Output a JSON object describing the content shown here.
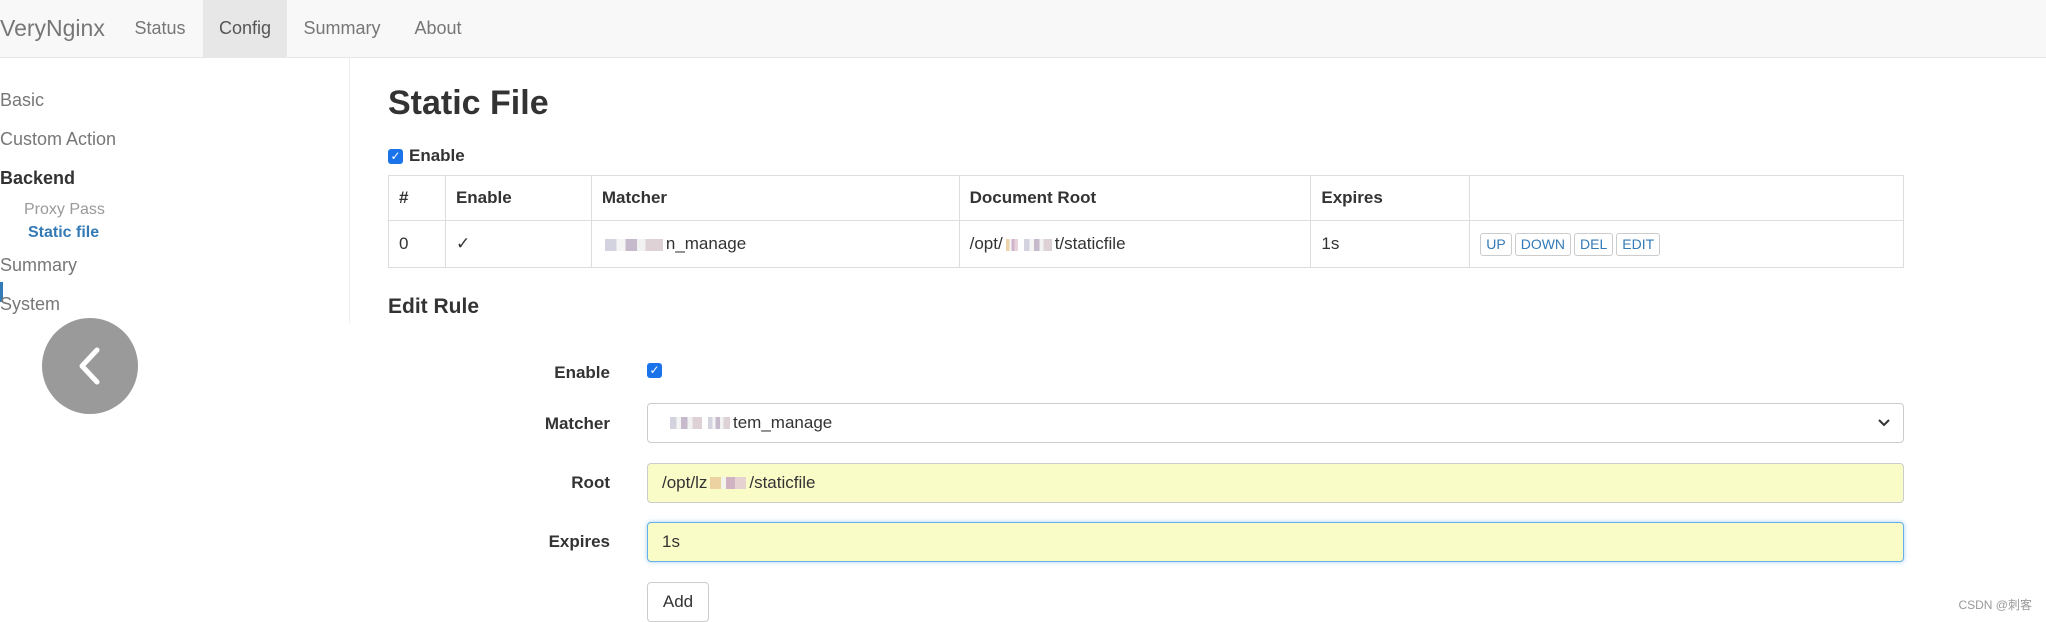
{
  "navbar": {
    "brand": "VeryNginx",
    "items": [
      "Status",
      "Config",
      "Summary",
      "About"
    ],
    "active": "Config"
  },
  "sidebar": {
    "basic": "Basic",
    "custom_action": "Custom Action",
    "backend": "Backend",
    "proxy_pass": "Proxy Pass",
    "static_file": "Static file",
    "summary": "Summary",
    "system": "System",
    "back_icon": "chevron-left-icon"
  },
  "main": {
    "title": "Static File",
    "enable_label": "Enable",
    "table": {
      "headers": [
        "#",
        "Enable",
        "Matcher",
        "Document Root",
        "Expires",
        ""
      ],
      "rows": [
        {
          "index": "0",
          "enable": "✓",
          "matcher_suffix": "n_manage",
          "root_prefix": "/opt/",
          "root_suffix": "t/staticfile",
          "expires": "1s"
        }
      ],
      "actions": [
        "UP",
        "DOWN",
        "DEL",
        "EDIT"
      ]
    },
    "edit_rule": {
      "title": "Edit Rule",
      "enable_label": "Enable",
      "matcher_label": "Matcher",
      "matcher_value_suffix": "tem_manage",
      "root_label": "Root",
      "root_value_prefix": "/opt/lz",
      "root_value_suffix": "/staticfile",
      "expires_label": "Expires",
      "expires_value": "1s",
      "add_label": "Add"
    }
  },
  "watermark": "CSDN @刺客"
}
